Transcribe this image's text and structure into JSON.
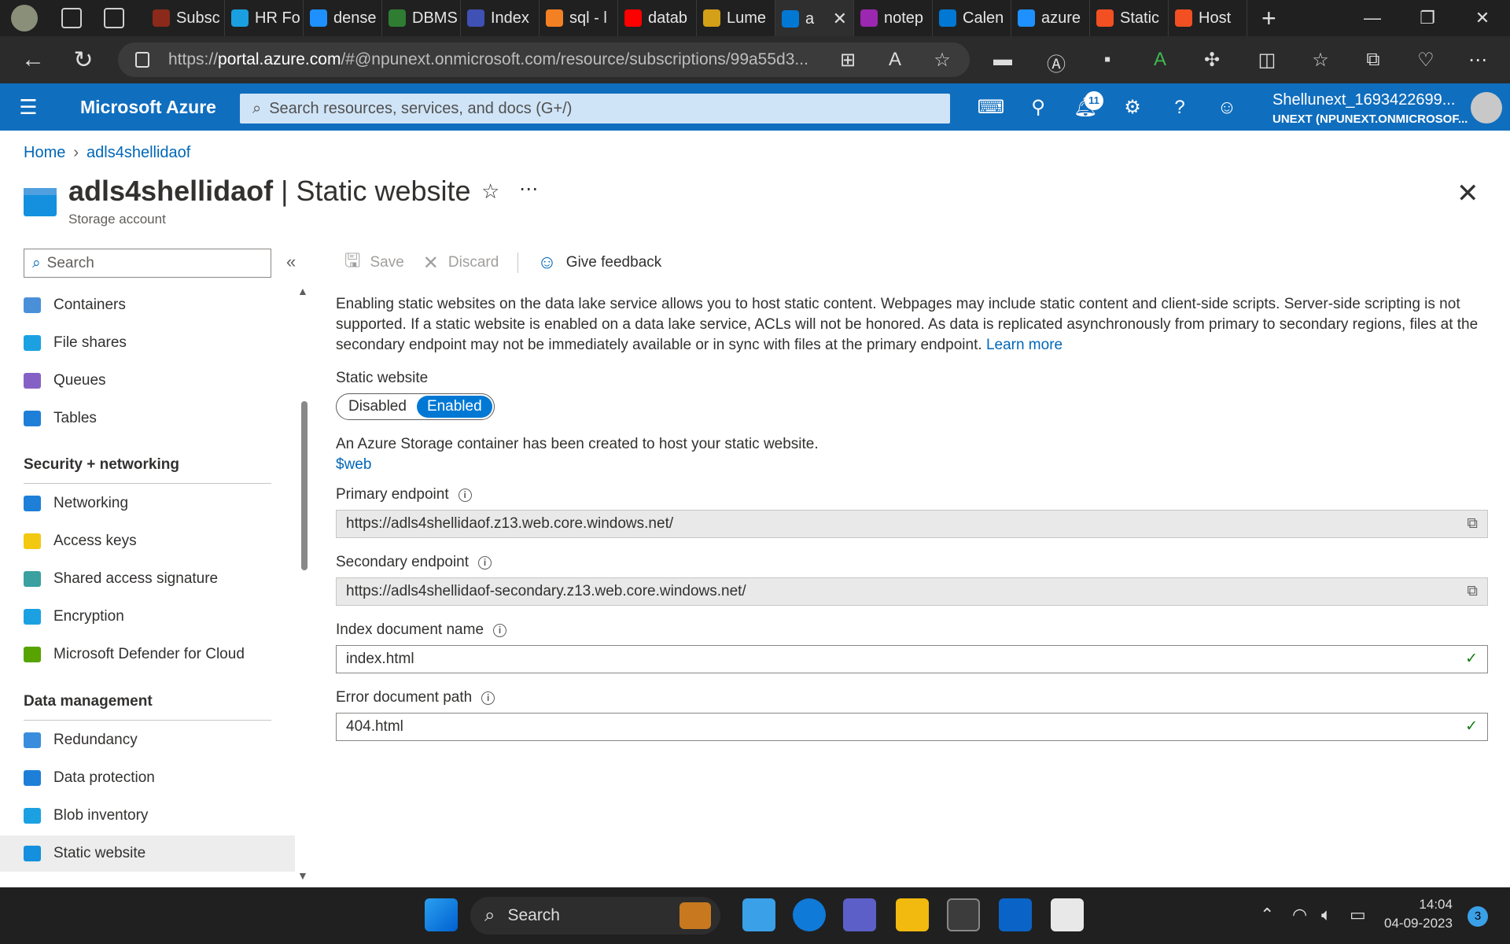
{
  "browser": {
    "tabs": [
      {
        "label": "Subsc",
        "color": "#8b2a1a"
      },
      {
        "label": "HR Fo",
        "color": "#1a9fe0"
      },
      {
        "label": "dense",
        "color": "#1e90ff"
      },
      {
        "label": "DBMS",
        "color": "#2e7d32"
      },
      {
        "label": "Index",
        "color": "#3f51b5"
      },
      {
        "label": "sql - l",
        "color": "#f48024"
      },
      {
        "label": "datab",
        "color": "#ff0000"
      },
      {
        "label": "Lume",
        "color": "#d4a017"
      },
      {
        "label": "a",
        "color": "#0078d4"
      },
      {
        "label": "notep",
        "color": "#9c27b0"
      },
      {
        "label": "Calen",
        "color": "#0078d4"
      },
      {
        "label": "azure",
        "color": "#1e90ff"
      },
      {
        "label": "Static",
        "color": "#f25022"
      },
      {
        "label": "Host",
        "color": "#f25022"
      }
    ],
    "active_tab_index": 8,
    "url_prefix": "https://",
    "url_host": "portal.azure.com",
    "url_rest": "/#@npunext.onmicrosoft.com/resource/subscriptions/99a55d3..."
  },
  "azure": {
    "brand": "Microsoft Azure",
    "search_placeholder": "Search resources, services, and docs (G+/)",
    "notifications_count": "11",
    "account_name": "Shellunext_1693422699...",
    "account_tenant": "UNEXT (NPUNEXT.ONMICROSOF..."
  },
  "breadcrumb": {
    "home": "Home",
    "resource": "adls4shellidaof"
  },
  "page": {
    "resource_name": "adls4shellidaof",
    "separator": " | ",
    "blade_name": "Static website",
    "resource_type": "Storage account"
  },
  "sidebar": {
    "search_placeholder": "Search",
    "items_top": [
      {
        "label": "Containers",
        "icon": "containers-icon",
        "color": "#4a90d9"
      },
      {
        "label": "File shares",
        "icon": "file-shares-icon",
        "color": "#1ba1e2"
      },
      {
        "label": "Queues",
        "icon": "queues-icon",
        "color": "#8661c5"
      },
      {
        "label": "Tables",
        "icon": "tables-icon",
        "color": "#1e7fd8"
      }
    ],
    "section_security": "Security + networking",
    "items_security": [
      {
        "label": "Networking",
        "icon": "networking-icon",
        "color": "#1e7fd8"
      },
      {
        "label": "Access keys",
        "icon": "key-icon",
        "color": "#f2c811"
      },
      {
        "label": "Shared access signature",
        "icon": "link-icon",
        "color": "#3aa0a0"
      },
      {
        "label": "Encryption",
        "icon": "lock-icon",
        "color": "#1ba1e2"
      },
      {
        "label": "Microsoft Defender for Cloud",
        "icon": "shield-icon",
        "color": "#57a300"
      }
    ],
    "section_data": "Data management",
    "items_data": [
      {
        "label": "Redundancy",
        "icon": "globe-icon",
        "color": "#3a8ddd"
      },
      {
        "label": "Data protection",
        "icon": "shield-icon",
        "color": "#1e7fd8"
      },
      {
        "label": "Blob inventory",
        "icon": "inventory-icon",
        "color": "#1ba1e2"
      },
      {
        "label": "Static website",
        "icon": "website-icon",
        "color": "#1490df"
      }
    ]
  },
  "toolbar": {
    "save": "Save",
    "discard": "Discard",
    "feedback": "Give feedback"
  },
  "content": {
    "description": "Enabling static websites on the data lake service allows you to host static content. Webpages may include static content and client-side scripts. Server-side scripting is not supported. If a static website is enabled on a data lake service, ACLs will not be honored. As data is replicated asynchronously from primary to secondary regions, files at the secondary endpoint may not be immediately available or in sync with files at the primary endpoint.",
    "learn_more": "Learn more",
    "static_website_label": "Static website",
    "toggle_disabled": "Disabled",
    "toggle_enabled": "Enabled",
    "container_msg": "An Azure Storage container has been created to host your static website.",
    "container_link": "$web",
    "primary_label": "Primary endpoint",
    "primary_value": "https://adls4shellidaof.z13.web.core.windows.net/",
    "secondary_label": "Secondary endpoint",
    "secondary_value": "https://adls4shellidaof-secondary.z13.web.core.windows.net/",
    "index_label": "Index document name",
    "index_value": "index.html",
    "error_label": "Error document path",
    "error_value": "404.html"
  },
  "taskbar": {
    "search_label": "Search",
    "time": "14:04",
    "date": "04-09-2023",
    "notification_count": "3"
  }
}
